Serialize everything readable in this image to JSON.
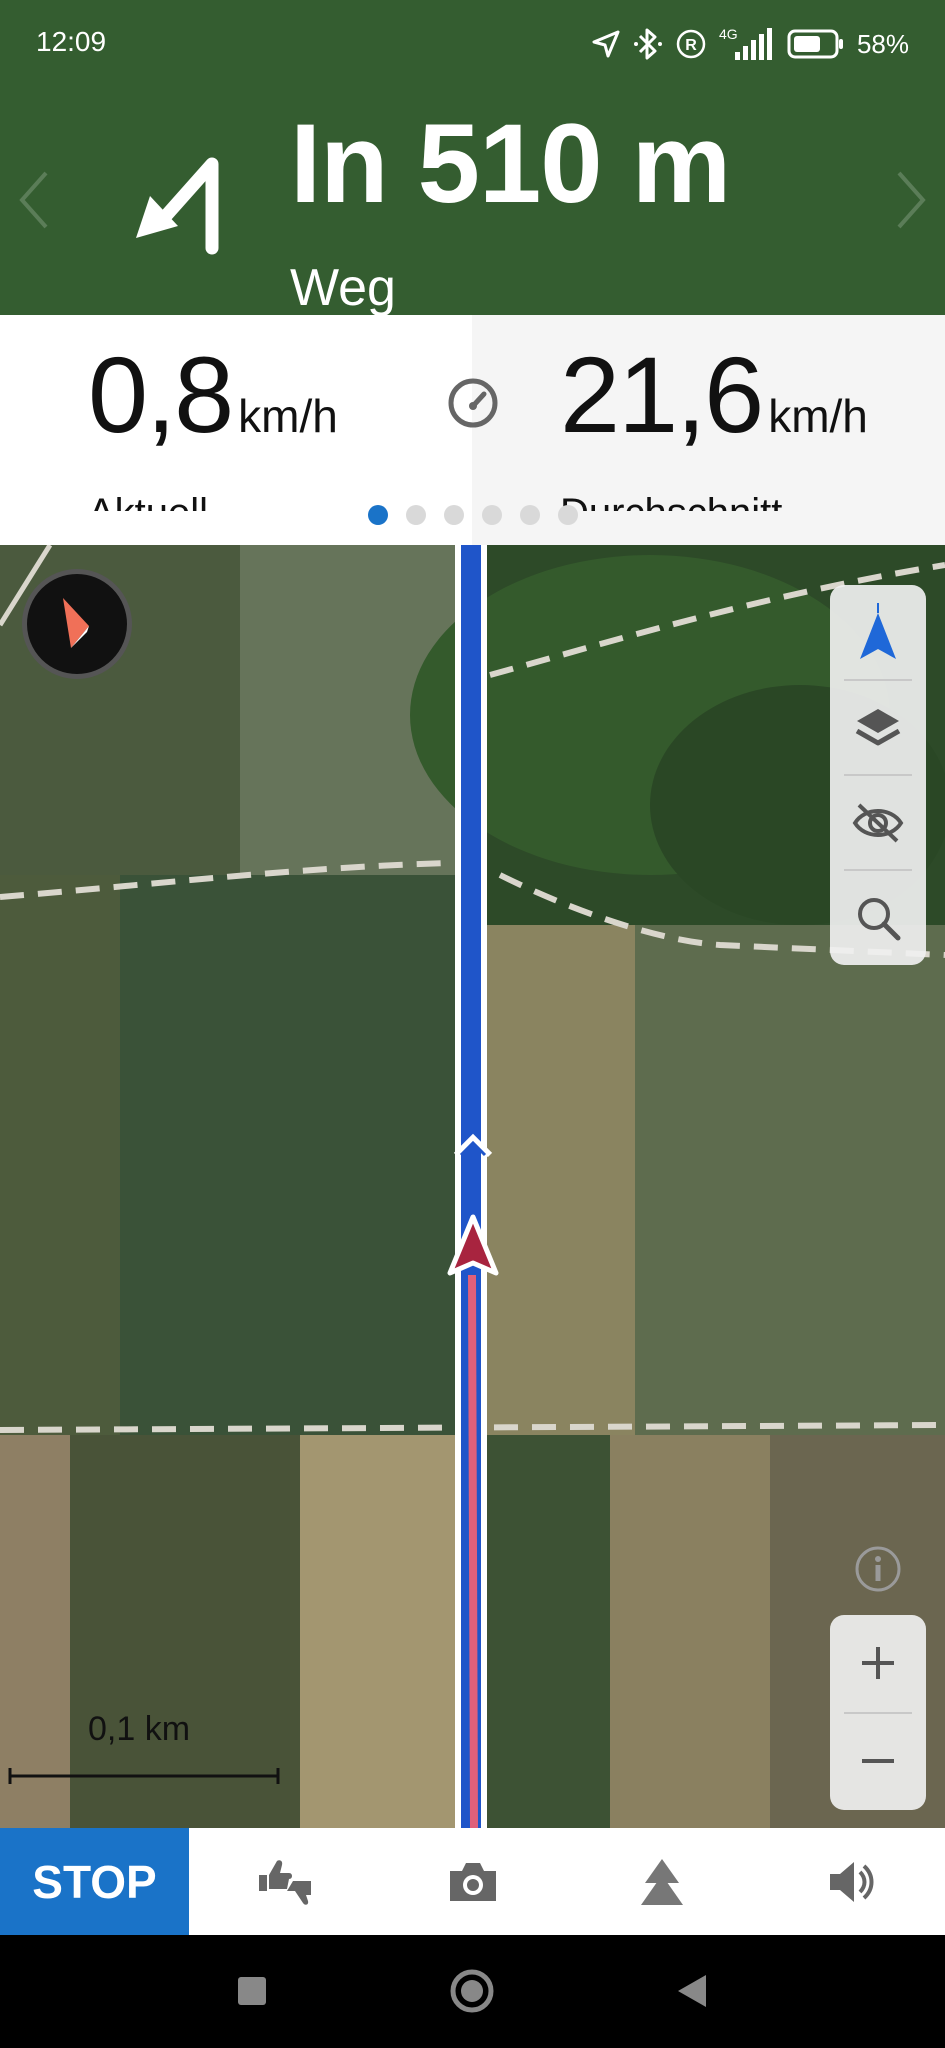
{
  "status_bar": {
    "time": "12:09",
    "network": "4G",
    "battery": "58%",
    "icons": [
      "location-arrow-icon",
      "bluetooth-icon",
      "roaming-icon",
      "signal-icon",
      "battery-icon"
    ]
  },
  "navigation": {
    "distance": "In 510 m",
    "street": "Weg",
    "turn_icon": "turn-sharp-left-icon"
  },
  "stats": {
    "current": {
      "value": "0,8",
      "unit": "km/h",
      "label": "Aktuell"
    },
    "average": {
      "value": "21,6",
      "unit": "km/h",
      "label": "Durchschnitt"
    },
    "page_count": 6,
    "active_page": 1
  },
  "map": {
    "scale_label": "0,1 km",
    "controls": [
      "location-arrow-icon",
      "layers-icon",
      "eye-off-icon",
      "search-icon"
    ],
    "zoom": [
      "zoom-in-icon",
      "zoom-out-icon"
    ]
  },
  "toolbar": {
    "stop_label": "STOP",
    "icons": [
      "thumbs-icon",
      "camera-icon",
      "direction-icon",
      "volume-icon"
    ]
  },
  "colors": {
    "header_bg": "#345d30",
    "accent_blue": "#1a73c8",
    "route_blue": "#1f55c9",
    "position_marker": "#a8243f"
  }
}
